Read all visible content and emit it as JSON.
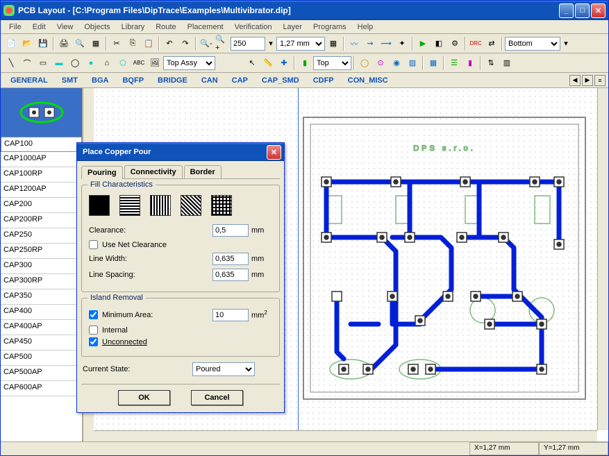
{
  "window": {
    "title": "PCB Layout - [C:\\Program Files\\DipTrace\\Examples\\Multivibrator.dip]"
  },
  "menu": [
    "File",
    "Edit",
    "View",
    "Objects",
    "Library",
    "Route",
    "Placement",
    "Verification",
    "Layer",
    "Programs",
    "Help"
  ],
  "toolbar": {
    "zoom": "250",
    "pitch": "1,27 mm",
    "layer_sel": "Bottom",
    "assy": "Top Assy",
    "side": "Top"
  },
  "tabs": [
    "GENERAL",
    "SMT",
    "BGA",
    "BQFP",
    "BRIDGE",
    "CAN",
    "CAP",
    "CAP_SMD",
    "CDFP",
    "CON_MISC"
  ],
  "components": [
    "CAP100",
    "CAP1000AP",
    "CAP100RP",
    "CAP1200AP",
    "CAP200",
    "CAP200RP",
    "CAP250",
    "CAP250RP",
    "CAP300",
    "CAP300RP",
    "CAP350",
    "CAP400",
    "CAP400AP",
    "CAP450",
    "CAP500",
    "CAP500AP",
    "CAP600AP"
  ],
  "components_selected": "CAP100",
  "board_text": "DPS  s.r.o.",
  "dialog": {
    "title": "Place Copper Pour",
    "tabs": [
      "Pouring",
      "Connectivity",
      "Border"
    ],
    "active_tab": "Pouring",
    "group_fill": "Fill Characteristics",
    "clearance_label": "Clearance:",
    "clearance": "0,5",
    "clearance_unit": "mm",
    "use_net": "Use Net Clearance",
    "use_net_checked": false,
    "linewidth_label": "Line Width:",
    "linewidth": "0,635",
    "linewidth_unit": "mm",
    "linespacing_label": "Line Spacing:",
    "linespacing": "0,635",
    "linespacing_unit": "mm",
    "group_island": "Island Removal",
    "minarea_label": "Minimum Area:",
    "minarea": "10",
    "minarea_unit": "mm",
    "minarea_checked": true,
    "internal": "Internal",
    "internal_checked": false,
    "unconnected": "Unconnected",
    "unconnected_checked": true,
    "state_label": "Current State:",
    "state": "Poured",
    "ok": "OK",
    "cancel": "Cancel"
  },
  "status": {
    "x": "X=1,27 mm",
    "y": "Y=1,27 mm"
  },
  "colors": {
    "trace": "#0020d8",
    "silk": "#7fbb7f",
    "board_outline": "#888"
  }
}
